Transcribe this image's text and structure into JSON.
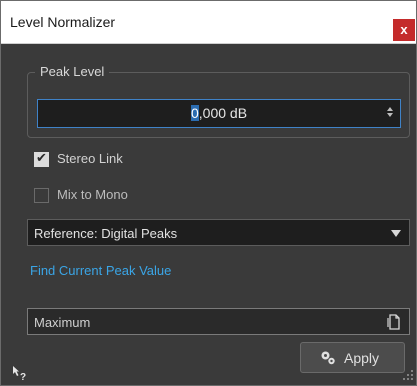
{
  "window": {
    "title": "Level Normalizer",
    "close_symbol": "x"
  },
  "peak_level": {
    "group_label": "Peak Level",
    "value_selected": "0",
    "value_rest": ",000 dB"
  },
  "options": {
    "stereo_link": {
      "label": "Stereo Link",
      "checked": true
    },
    "mix_to_mono": {
      "label": "Mix to Mono",
      "checked": false
    }
  },
  "reference": {
    "selected": "Reference: Digital Peaks"
  },
  "find_link": "Find Current Peak Value",
  "preset": {
    "value": "Maximum"
  },
  "apply": {
    "label": "Apply"
  },
  "colors": {
    "background": "#3a3a3a",
    "link": "#3aa5e6",
    "accent": "#3f82c7",
    "close": "#c42b2b"
  },
  "icons": [
    "close-icon",
    "spin-up-icon",
    "spin-down-icon",
    "checkmark-icon",
    "dropdown-arrow-icon",
    "document-icon",
    "gears-icon",
    "help-icon",
    "resize-grip-icon"
  ]
}
